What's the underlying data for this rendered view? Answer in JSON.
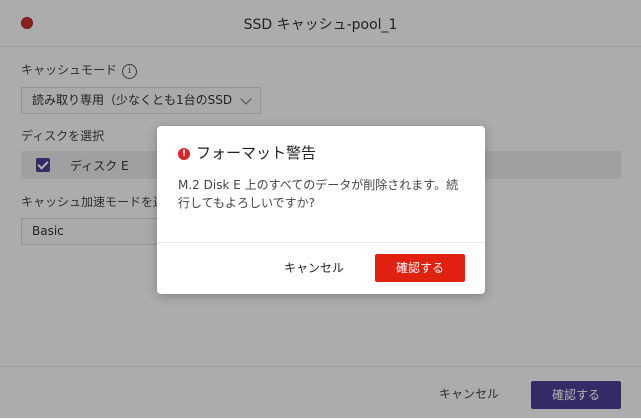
{
  "window": {
    "title": "SSD キャッシュ-pool_1"
  },
  "form": {
    "cache_mode_label": "キャッシュモード",
    "info_glyph": "i",
    "cache_mode_value": "読み取り専用（少なくとも1台のSSD",
    "disk_section_label": "ディスクを選択",
    "disk_name": "ディスク E",
    "accel_mode_label": "キャッシュ加速モードを選",
    "accel_mode_value": "Basic"
  },
  "footer": {
    "cancel_label": "キャンセル",
    "confirm_label": "確認する"
  },
  "dialog": {
    "title": "フォーマット警告",
    "warning_glyph": "!",
    "message": "M.2 Disk E 上のすべてのデータが削除されます。続行してもよろしいですか?",
    "cancel_label": "キャンセル",
    "confirm_label": "確認する"
  },
  "colors": {
    "accent_purple": "#4b3e93",
    "danger_red": "#e0210f",
    "close_red": "#c8312c"
  },
  "icons": {
    "close": "close-dot-icon",
    "info": "info-icon",
    "dropdown": "chevron-down-icon",
    "checkbox": "checkbox-checked-icon",
    "warning": "warning-icon"
  }
}
